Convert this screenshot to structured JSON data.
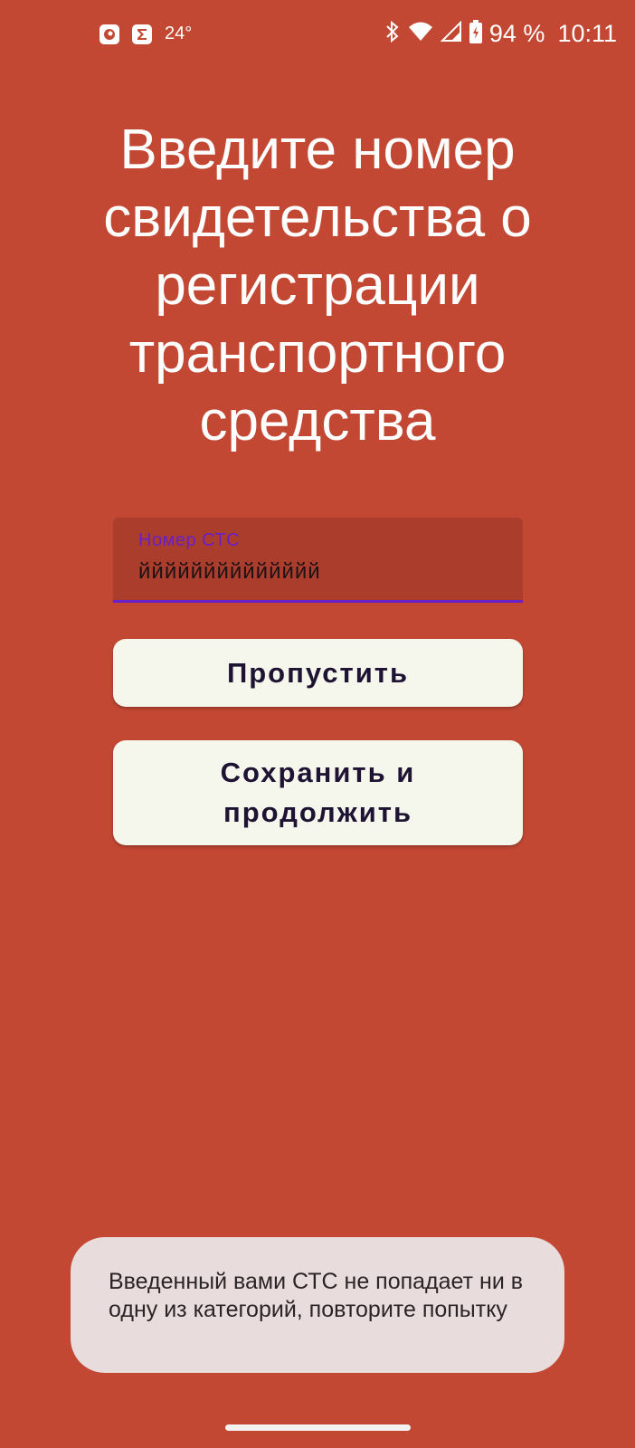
{
  "status_bar": {
    "temperature": "24°",
    "battery": "94 %",
    "time": "10:11",
    "icons": [
      "notification-app-icon",
      "sigma-app-icon",
      "bluetooth-icon",
      "wifi-icon",
      "cell-signal-icon",
      "battery-charging-icon"
    ]
  },
  "title": "Введите номер свидетельства о регистрации транспортного средства",
  "input": {
    "label": "Номер СТС",
    "value": "йййййййййййййй"
  },
  "buttons": {
    "skip_label": "Пропустить",
    "save_label": "Сохранить и продолжить"
  },
  "toast": {
    "message": "Введенный вами СТС не попадает ни в одну из категорий, повторите попытку"
  },
  "colors": {
    "background": "#c24834",
    "input_accent": "#6a1fc8",
    "button_bg": "#f5f7ec",
    "button_text": "#1f1333",
    "toast_bg": "#e8dcdc"
  }
}
